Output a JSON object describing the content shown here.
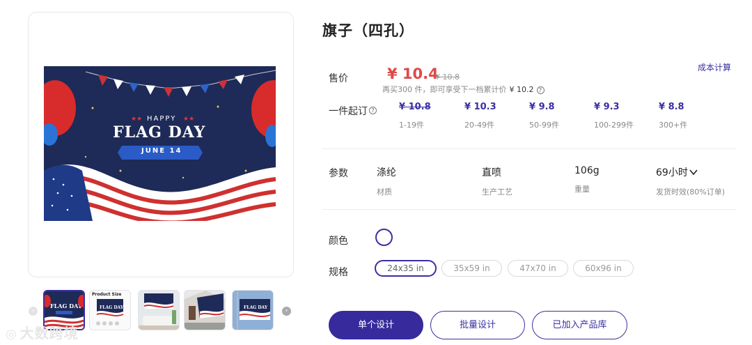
{
  "product": {
    "title": "旗子（四孔）"
  },
  "pricing": {
    "label": "售价",
    "cost_link": "成本计算",
    "current": "¥ 10.4",
    "original": "¥ 10.8",
    "note": "再买300 件，即可享受下一档累计价",
    "note_price": "¥ 10.2",
    "help": "?",
    "moq_label": "一件起订",
    "tiers": [
      {
        "price": "¥ 10.8",
        "range": "1-19件",
        "strike": true
      },
      {
        "price": "¥ 10.3",
        "range": "20-49件",
        "strike": false
      },
      {
        "price": "¥ 9.8",
        "range": "50-99件",
        "strike": false
      },
      {
        "price": "¥ 9.3",
        "range": "100-299件",
        "strike": false
      },
      {
        "price": "¥ 8.8",
        "range": "300+件",
        "strike": false
      }
    ]
  },
  "params": {
    "label": "参数",
    "items": [
      {
        "value": "涤纶",
        "name": "材质"
      },
      {
        "value": "直喷",
        "name": "生产工艺"
      },
      {
        "value": "106g",
        "name": "重量"
      },
      {
        "value": "69小时",
        "name": "发货时效(80%订单)",
        "dropdown_icon": "chevron-down-icon"
      }
    ]
  },
  "color": {
    "label": "颜色",
    "selected_color": "#ffffff",
    "ring_color": "#3a2fa0"
  },
  "size": {
    "label": "规格",
    "options": [
      "24x35 in",
      "35x59 in",
      "47x70 in",
      "60x96 in"
    ],
    "selected_index": 0
  },
  "actions": {
    "single_design": "单个设计",
    "batch_design": "批量设计",
    "added_to_library": "已加入产品库"
  },
  "gallery": {
    "banner": {
      "happy": "HAPPY",
      "headline": "FLAG DAY",
      "date": "JUNE 14"
    },
    "thumb_caption": "Product Size",
    "selected_thumb": 0,
    "prev_icon": "chevron-left-icon",
    "next_icon": "chevron-right-icon"
  },
  "watermark": "大数跨境",
  "colors": {
    "accent": "#3a2fa0",
    "price_red": "#e04848",
    "flag_navy": "#1e2a57"
  }
}
